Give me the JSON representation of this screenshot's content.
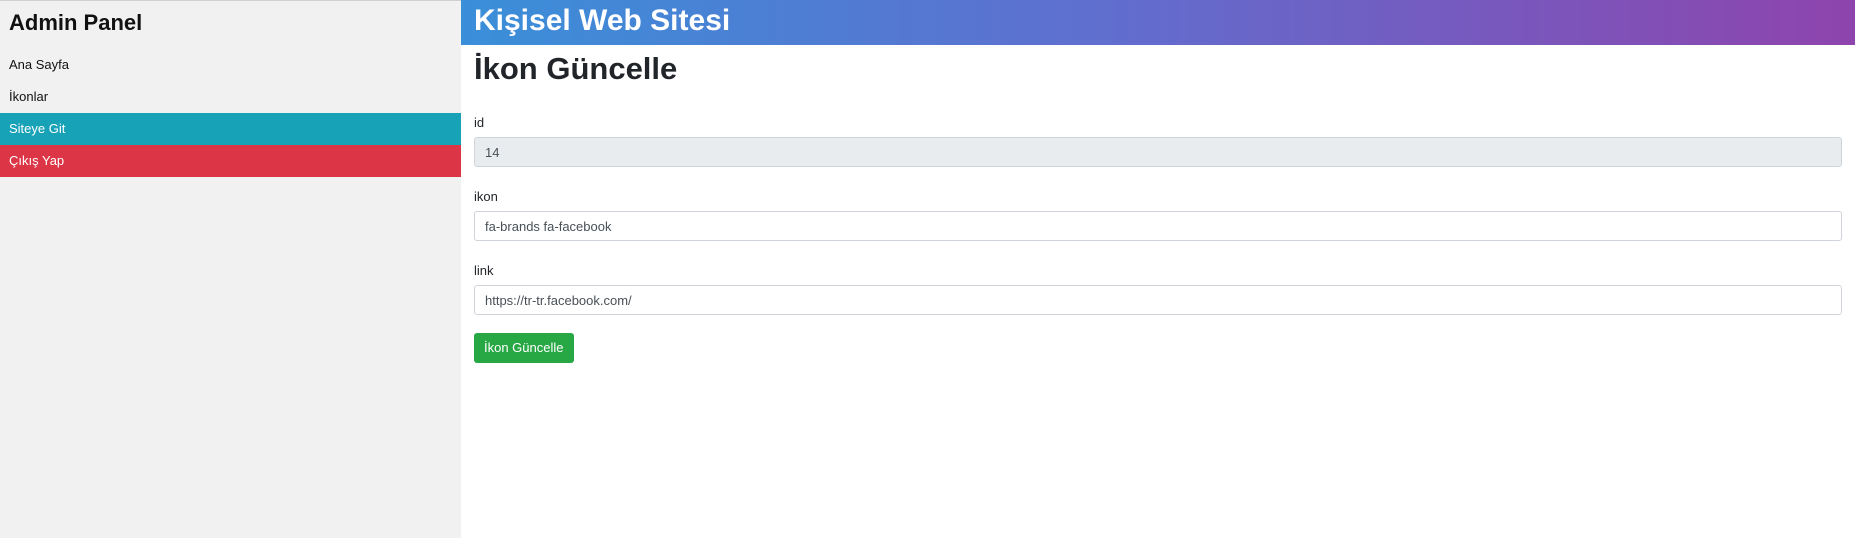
{
  "sidebar": {
    "title": "Admin Panel",
    "items": [
      {
        "label": "Ana Sayfa"
      },
      {
        "label": "İkonlar"
      },
      {
        "label": "Siteye Git"
      },
      {
        "label": "Çıkış Yap"
      }
    ]
  },
  "header": {
    "site_title": "Kişisel Web Sitesi"
  },
  "main": {
    "page_title": "İkon Güncelle",
    "form": {
      "id_label": "id",
      "id_value": "14",
      "ikon_label": "ikon",
      "ikon_value": "fa-brands fa-facebook",
      "link_label": "link",
      "link_value": "https://tr-tr.facebook.com/",
      "submit_label": "İkon Güncelle"
    }
  },
  "colors": {
    "info": "#17a2b8",
    "danger": "#dc3545",
    "success": "#28a745",
    "header_gradient_start": "#3a8fd9",
    "header_gradient_end": "#8e44ad"
  }
}
